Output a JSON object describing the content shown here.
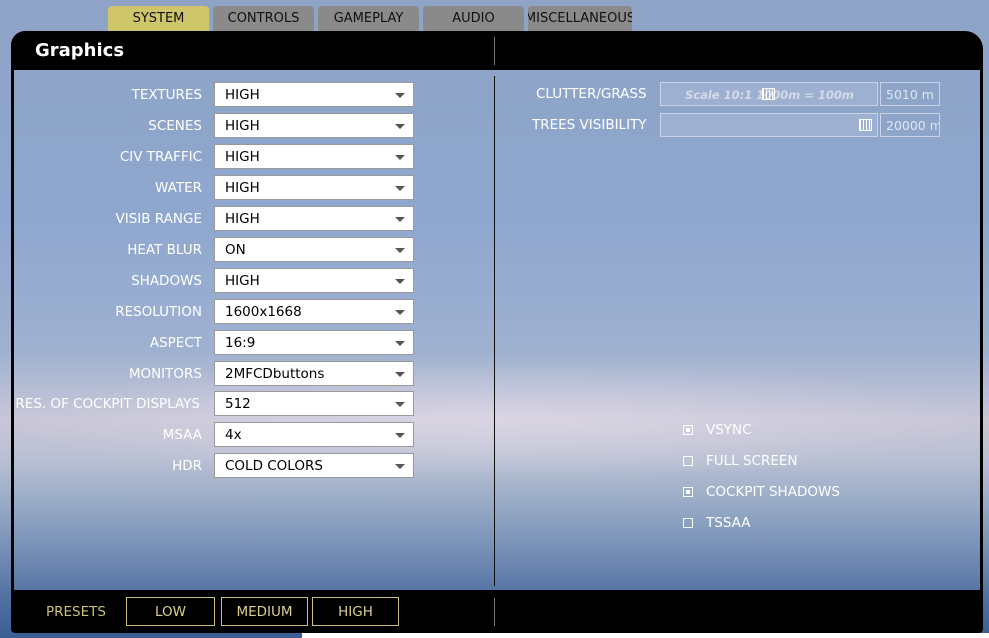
{
  "tabs": [
    {
      "label": "SYSTEM",
      "active": true
    },
    {
      "label": "CONTROLS",
      "active": false
    },
    {
      "label": "GAMEPLAY",
      "active": false
    },
    {
      "label": "AUDIO",
      "active": false
    },
    {
      "label": "MISCELLANEOUS",
      "active": false
    }
  ],
  "header": {
    "title": "Graphics"
  },
  "settings": [
    {
      "label": "TEXTURES",
      "value": "HIGH"
    },
    {
      "label": "SCENES",
      "value": "HIGH"
    },
    {
      "label": "CIV TRAFFIC",
      "value": "HIGH"
    },
    {
      "label": "WATER",
      "value": "HIGH"
    },
    {
      "label": "VISIB RANGE",
      "value": "HIGH"
    },
    {
      "label": "HEAT BLUR",
      "value": "ON"
    },
    {
      "label": "SHADOWS",
      "value": "HIGH"
    },
    {
      "label": "RESOLUTION",
      "value": "1600x1668"
    },
    {
      "label": "ASPECT",
      "value": "16:9"
    },
    {
      "label": "MONITORS",
      "value": "2MFCDbuttons"
    },
    {
      "label": "RES. OF COCKPIT DISPLAYS",
      "value": "512"
    },
    {
      "label": "MSAA",
      "value": "4x"
    },
    {
      "label": "HDR",
      "value": "COLD COLORS"
    }
  ],
  "sliders": [
    {
      "label": "CLUTTER/GRASS",
      "scale_text": "Scale 10:1   1000m = 100m",
      "value": "5010 m",
      "level": 0.5
    },
    {
      "label": "TREES VISIBILITY",
      "scale_text": "",
      "value": "20000 m",
      "level": 1.0
    }
  ],
  "checkboxes": [
    {
      "label": "VSYNC",
      "checked": true
    },
    {
      "label": "FULL SCREEN",
      "checked": false
    },
    {
      "label": "COCKPIT SHADOWS",
      "checked": true
    },
    {
      "label": "TSSAA",
      "checked": false
    }
  ],
  "footer": {
    "presets_label": "PRESETS",
    "presets": [
      "LOW",
      "MEDIUM",
      "HIGH"
    ]
  },
  "colors": {
    "active_tab": "#cfc56a",
    "inactive_tab": "#8a8a8a",
    "preset_accent": "#c8c27d"
  }
}
